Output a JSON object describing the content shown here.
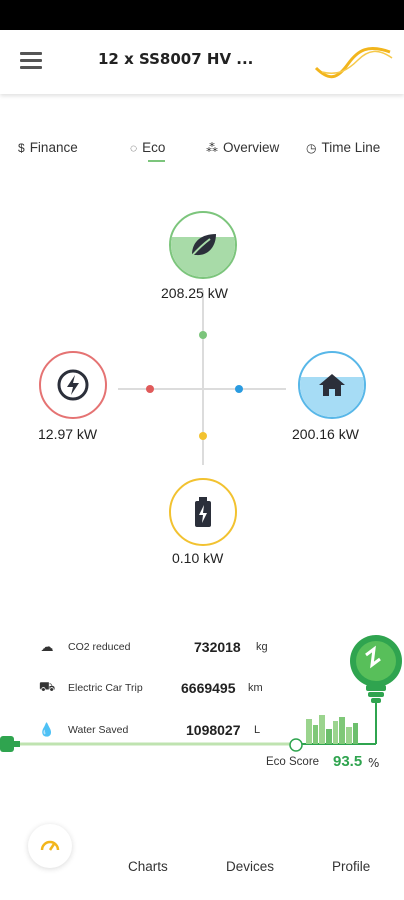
{
  "header": {
    "title": "12 x SS8007 HV ..."
  },
  "tabs": [
    {
      "icon": "dollar-icon",
      "label": "Finance"
    },
    {
      "icon": "leaf-circle-icon",
      "label": "Eco"
    },
    {
      "icon": "nodes-icon",
      "label": "Overview"
    },
    {
      "icon": "clock-icon",
      "label": "Time Line"
    }
  ],
  "active_tab": "Eco",
  "flow": {
    "solar": {
      "icon": "leaf-icon",
      "value": "208.25 kW",
      "color": "#7cc57c"
    },
    "grid": {
      "icon": "lightning-icon",
      "value": "12.97 kW",
      "color": "#e57373"
    },
    "home": {
      "icon": "house-icon",
      "value": "200.16 kW",
      "color": "#58b7e8"
    },
    "battery": {
      "icon": "battery-icon",
      "value": "0.10 kW",
      "color": "#f2c230"
    }
  },
  "eco": {
    "items": [
      {
        "icon": "co2-cloud-icon",
        "label": "CO2 reduced",
        "value": "732018",
        "unit": "kg"
      },
      {
        "icon": "car-icon",
        "label": "Electric Car Trip",
        "value": "6669495",
        "unit": "km"
      },
      {
        "icon": "water-hand-icon",
        "label": "Water Saved",
        "value": "1098027",
        "unit": "L"
      }
    ],
    "score_label": "Eco Score",
    "score_value": "93.5",
    "score_unit": "%"
  },
  "bottom_nav": {
    "fab_icon": "speedometer-icon",
    "items": [
      "Charts",
      "Devices",
      "Profile"
    ]
  }
}
